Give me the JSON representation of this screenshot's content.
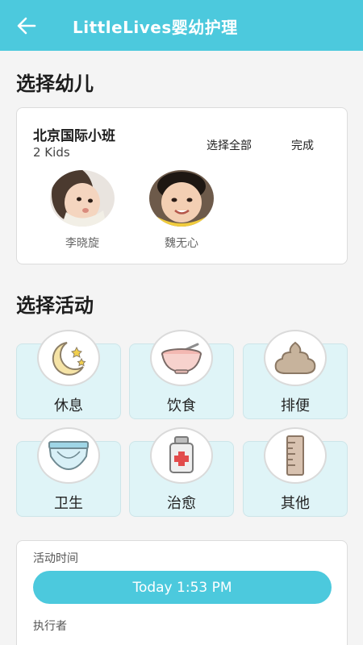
{
  "appbar": {
    "title": "LittleLives婴幼护理"
  },
  "kids_section": {
    "title": "选择幼儿",
    "class_name": "北京国际小班",
    "kids_count": "2 Kids",
    "select_all": "选择全部",
    "done": "完成",
    "kids": [
      {
        "name": "李晓旋"
      },
      {
        "name": "魏无心"
      }
    ]
  },
  "activity_section": {
    "title": "选择活动",
    "activities": [
      {
        "label": "休息",
        "icon": "moon-stars-icon"
      },
      {
        "label": "饮食",
        "icon": "food-bowl-icon"
      },
      {
        "label": "排便",
        "icon": "poop-icon"
      },
      {
        "label": "卫生",
        "icon": "diaper-icon"
      },
      {
        "label": "治愈",
        "icon": "medicine-bottle-icon"
      },
      {
        "label": "其他",
        "icon": "ruler-icon"
      }
    ]
  },
  "details": {
    "time_label": "活动时间",
    "time_value": "Today 1:53 PM",
    "performer_label": "执行者"
  },
  "colors": {
    "accent": "#4cc9dd",
    "tile": "#dff4f7"
  }
}
